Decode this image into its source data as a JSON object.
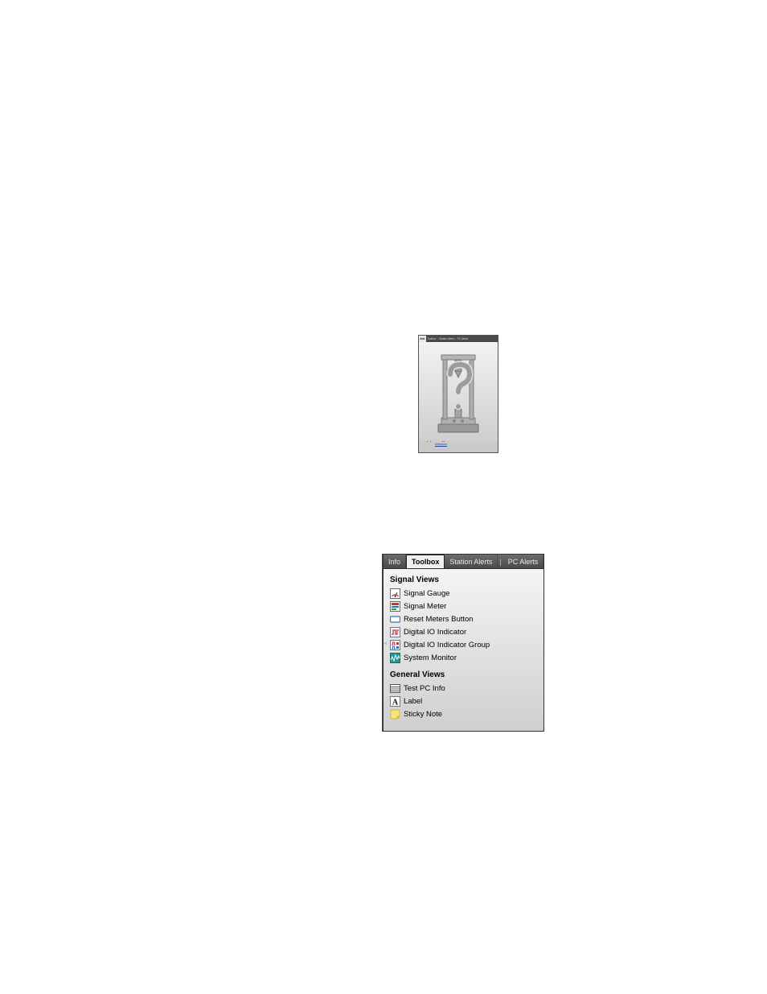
{
  "panel1": {
    "tabs": {
      "info": "Info",
      "toolbox": "Toolbox",
      "station_alerts": "Station Alerts",
      "pc_alerts": "PC Alerts"
    },
    "equipment_type_label": "Equipment Type",
    "equipment_type_value": "Unknown"
  },
  "panel2": {
    "tabs": {
      "info": "Info",
      "toolbox": "Toolbox",
      "station_alerts": "Station Alerts",
      "pc_alerts": "PC Alerts"
    },
    "sections": {
      "signal_views": {
        "title": "Signal Views",
        "items": [
          "Signal Gauge",
          "Signal Meter",
          "Reset Meters Button",
          "Digital IO Indicator",
          "Digital IO Indicator Group",
          "System Monitor"
        ]
      },
      "general_views": {
        "title": "General Views",
        "items": [
          "Test PC Info",
          "Label",
          "Sticky Note"
        ]
      }
    }
  }
}
